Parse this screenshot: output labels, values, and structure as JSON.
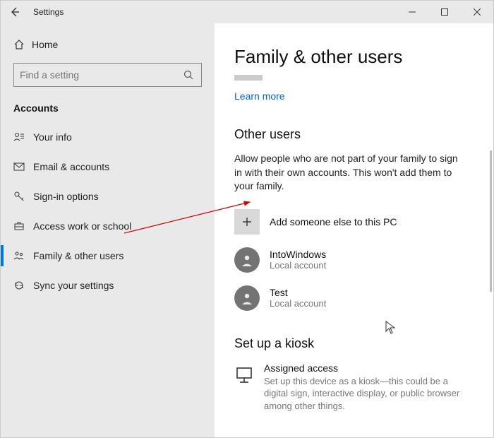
{
  "titlebar": {
    "title": "Settings"
  },
  "sidebar": {
    "home": "Home",
    "search_placeholder": "Find a setting",
    "group": "Accounts",
    "items": [
      {
        "label": "Your info"
      },
      {
        "label": "Email & accounts"
      },
      {
        "label": "Sign-in options"
      },
      {
        "label": "Access work or school"
      },
      {
        "label": "Family & other users"
      },
      {
        "label": "Sync your settings"
      }
    ]
  },
  "main": {
    "title": "Family & other users",
    "learn_more": "Learn more",
    "other_users": {
      "heading": "Other users",
      "description": "Allow people who are not part of your family to sign in with their own accounts. This won't add them to your family.",
      "add_label": "Add someone else to this PC",
      "users": [
        {
          "name": "IntoWindows",
          "type": "Local account"
        },
        {
          "name": "Test",
          "type": "Local account"
        }
      ]
    },
    "kiosk": {
      "heading": "Set up a kiosk",
      "title": "Assigned access",
      "description": "Set up this device as a kiosk—this could be a digital sign, interactive display, or public browser among other things."
    }
  }
}
